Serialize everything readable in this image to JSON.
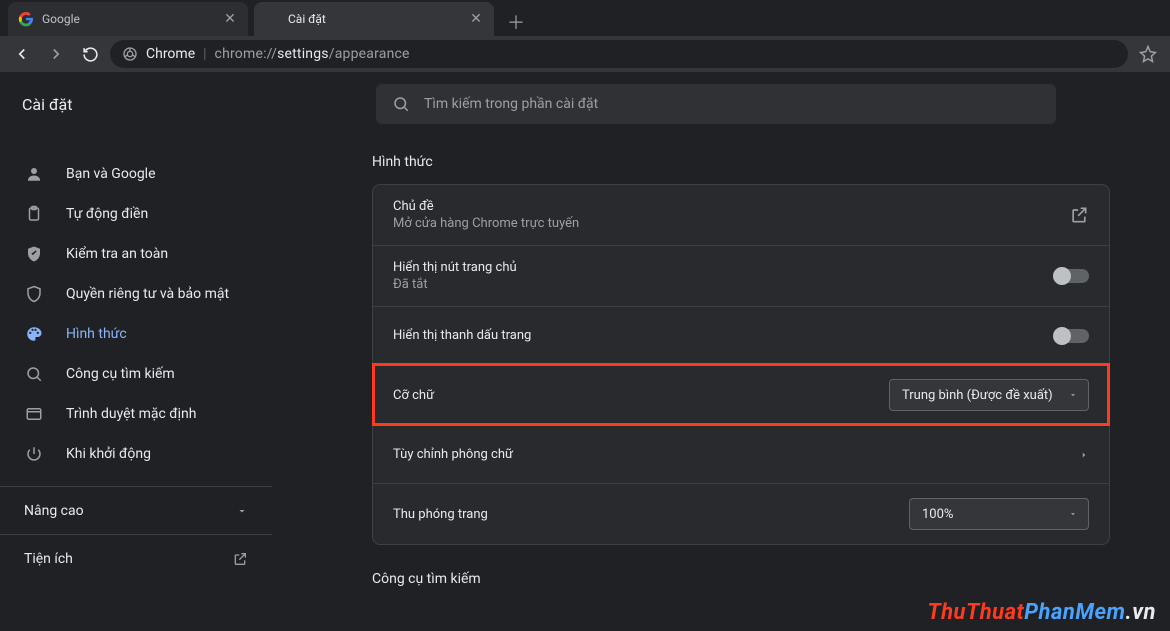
{
  "tabs": {
    "items": [
      {
        "title": "Google",
        "active": false
      },
      {
        "title": "Cài đặt",
        "active": true
      }
    ]
  },
  "omnibox": {
    "chip": "Chrome",
    "url_dim1": "chrome://",
    "url_lit": "settings",
    "url_dim2": "/appearance"
  },
  "header": {
    "title": "Cài đặt",
    "search_placeholder": "Tìm kiếm trong phần cài đặt"
  },
  "sidebar": {
    "items": [
      {
        "icon": "person",
        "label": "Bạn và Google"
      },
      {
        "icon": "clipboard",
        "label": "Tự động điền"
      },
      {
        "icon": "shield-check",
        "label": "Kiểm tra an toàn"
      },
      {
        "icon": "shield",
        "label": "Quyền riêng tư và bảo mật"
      },
      {
        "icon": "palette",
        "label": "Hình thức",
        "active": true
      },
      {
        "icon": "search",
        "label": "Công cụ tìm kiếm"
      },
      {
        "icon": "browser",
        "label": "Trình duyệt mặc định"
      },
      {
        "icon": "power",
        "label": "Khi khởi động"
      }
    ],
    "advanced": "Nâng cao",
    "extensions": "Tiện ích"
  },
  "main": {
    "section1_title": "Hình thức",
    "rows": {
      "theme": {
        "label": "Chủ đề",
        "sub": "Mở cửa hàng Chrome trực tuyến"
      },
      "home_btn": {
        "label": "Hiển thị nút trang chủ",
        "sub": "Đã tắt"
      },
      "bookmarks_bar": {
        "label": "Hiển thị thanh dấu trang"
      },
      "font_size": {
        "label": "Cỡ chữ",
        "value": "Trung bình (Được đề xuất)"
      },
      "custom_font": {
        "label": "Tùy chỉnh phông chữ"
      },
      "page_zoom": {
        "label": "Thu phóng trang",
        "value": "100%"
      }
    },
    "section2_title": "Công cụ tìm kiếm"
  },
  "watermark": {
    "a": "ThuThuat",
    "b": "PhanMem",
    "c": ".vn"
  }
}
